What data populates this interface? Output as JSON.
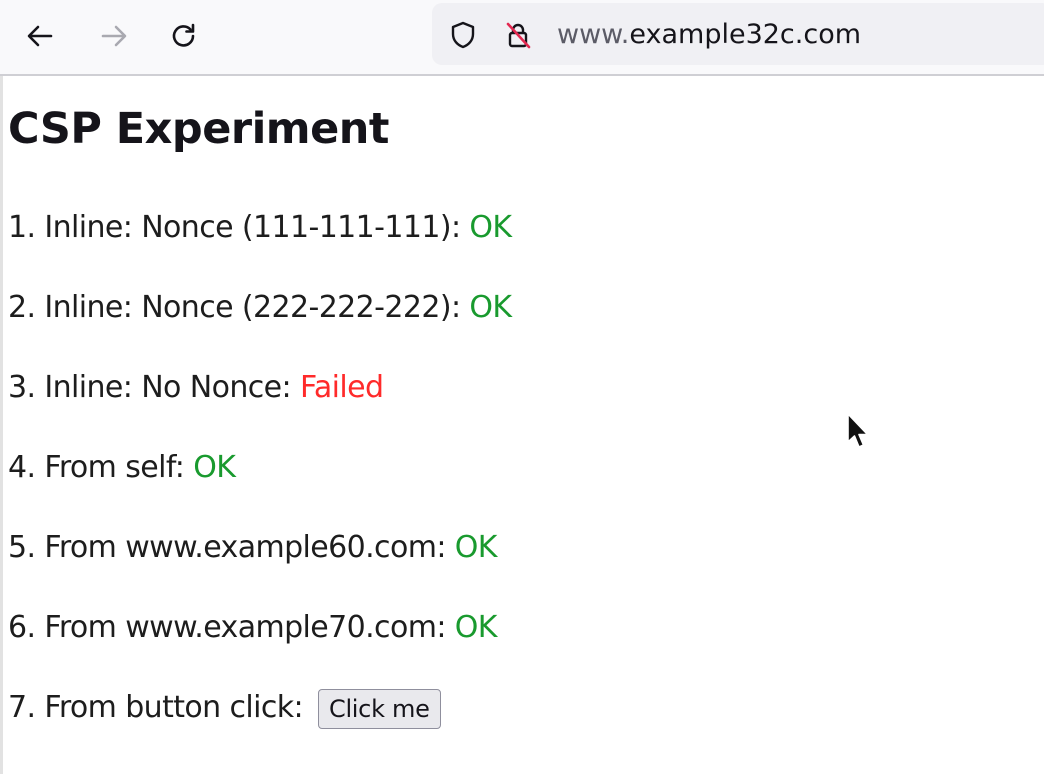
{
  "browser": {
    "url_prefix": "www.",
    "url_host": "example32c.com",
    "icons": [
      "back-arrow-icon",
      "forward-arrow-icon",
      "reload-icon",
      "shield-icon",
      "insecure-lock-icon"
    ]
  },
  "page": {
    "title": "CSP Experiment",
    "items": [
      {
        "label": "1. Inline: Nonce (111-111-111): ",
        "status": "OK",
        "status_kind": "ok"
      },
      {
        "label": "2. Inline: Nonce (222-222-222): ",
        "status": "OK",
        "status_kind": "ok"
      },
      {
        "label": "3. Inline: No Nonce: ",
        "status": "Failed",
        "status_kind": "fail"
      },
      {
        "label": "4. From self: ",
        "status": "OK",
        "status_kind": "ok"
      },
      {
        "label": "5. From www.example60.com: ",
        "status": "OK",
        "status_kind": "ok"
      },
      {
        "label": "6. From www.example70.com: ",
        "status": "OK",
        "status_kind": "ok"
      }
    ],
    "button_item": {
      "label": "7. From button click: ",
      "button_label": "Click me"
    }
  },
  "colors": {
    "ok": "#199a2e",
    "fail": "#ff2a2a"
  }
}
